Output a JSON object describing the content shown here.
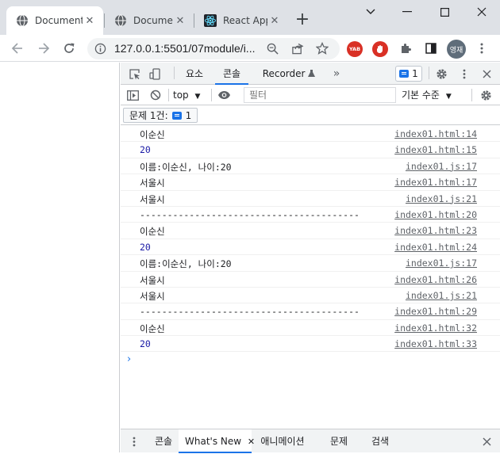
{
  "tabs": [
    {
      "title": "Document",
      "active": true,
      "icon": "globe-icon"
    },
    {
      "title": "Document",
      "active": false,
      "icon": "globe-icon"
    },
    {
      "title": "React App",
      "active": false,
      "icon": "react-icon"
    }
  ],
  "address": {
    "url": "127.0.0.1:5501/07module/i..."
  },
  "profile": {
    "initials": "영재"
  },
  "ext": {
    "yab_label": "YAB"
  },
  "devtools": {
    "tabs": {
      "elements": "요소",
      "console": "콘솔",
      "recorder": "Recorder",
      "more": "»"
    },
    "issue_count": "1",
    "context": "top",
    "filter_placeholder": "필터",
    "level": "기본 수준",
    "issues_label": "문제 1건:",
    "issues_count": "1",
    "logs": [
      {
        "msg": "이순신",
        "src": "index01.html:14",
        "num": false
      },
      {
        "msg": "20",
        "src": "index01.html:15",
        "num": true
      },
      {
        "msg": "이름:이순신, 나이:20",
        "src": "index01.js:17",
        "num": false
      },
      {
        "msg": "서울시",
        "src": "index01.html:17",
        "num": false
      },
      {
        "msg": "서울시",
        "src": "index01.js:21",
        "num": false
      },
      {
        "msg": "----------------------------------------",
        "src": "index01.html:20",
        "num": false
      },
      {
        "msg": "이순신",
        "src": "index01.html:23",
        "num": false
      },
      {
        "msg": "20",
        "src": "index01.html:24",
        "num": true
      },
      {
        "msg": "이름:이순신, 나이:20",
        "src": "index01.js:17",
        "num": false
      },
      {
        "msg": "서울시",
        "src": "index01.html:26",
        "num": false
      },
      {
        "msg": "서울시",
        "src": "index01.js:21",
        "num": false
      },
      {
        "msg": "----------------------------------------",
        "src": "index01.html:29",
        "num": false
      },
      {
        "msg": "이순신",
        "src": "index01.html:32",
        "num": false
      },
      {
        "msg": "20",
        "src": "index01.html:33",
        "num": true
      }
    ],
    "prompt": "›",
    "drawer": {
      "console": "콘솔",
      "whats_new": "What's New",
      "animation": "애니메이션",
      "issues": "문제",
      "search": "검색"
    }
  },
  "colors": {
    "accent": "#1a73e8",
    "number": "#1a1aa6",
    "yab": "#d93025",
    "shield": "#d93025"
  }
}
